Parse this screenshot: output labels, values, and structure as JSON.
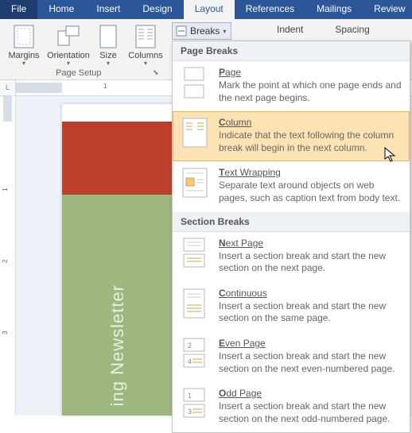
{
  "tabs": {
    "file": "File",
    "home": "Home",
    "insert": "Insert",
    "design": "Design",
    "layout": "Layout",
    "references": "References",
    "mailings": "Mailings",
    "review": "Review"
  },
  "ribbon": {
    "margins": "Margins",
    "orientation": "Orientation",
    "size": "Size",
    "columns": "Columns",
    "group_label": "Page Setup",
    "breaks": "Breaks",
    "indent": "Indent",
    "spacing": "Spacing"
  },
  "dropdown": {
    "head1": "Page Breaks",
    "page": {
      "title": "Page",
      "desc": "Mark the point at which one page ends and the next page begins."
    },
    "column": {
      "title": "Column",
      "desc": "Indicate that the text following the column break will begin in the next column."
    },
    "textwrap": {
      "title": "Text Wrapping",
      "desc": "Separate text around objects on web pages, such as caption text from body text."
    },
    "head2": "Section Breaks",
    "nextpage": {
      "title": "Next Page",
      "desc": "Insert a section break and start the new section on the next page."
    },
    "continuous": {
      "title": "Continuous",
      "desc": "Insert a section break and start the new section on the same page."
    },
    "evenpage": {
      "title": "Even Page",
      "desc": "Insert a section break and start the new section on the next even-numbered page."
    },
    "oddpage": {
      "title": "Odd Page",
      "desc": "Insert a section break and start the new section on the next odd-numbered page."
    }
  },
  "doc": {
    "corner": "L",
    "newsletter_text": "ing Newsletter"
  }
}
